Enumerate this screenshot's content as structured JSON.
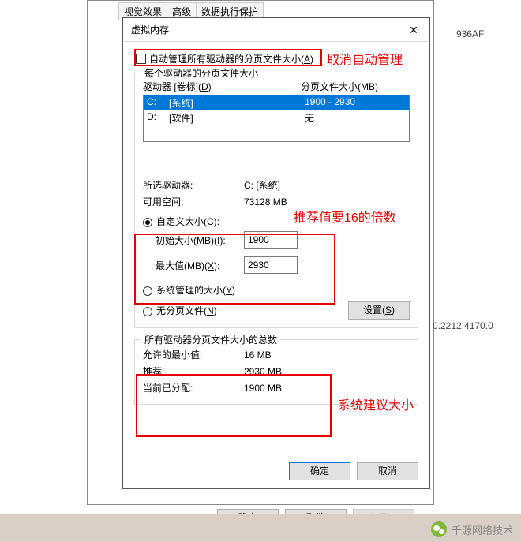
{
  "bg_text_1": "936AF",
  "bg_text_2": "0.2212.4170.0",
  "parent_tabs": {
    "t1": "视觉效果",
    "t2": "高级",
    "t3": "数据执行保护"
  },
  "parent_buttons": {
    "ok": "确定",
    "cancel": "取消",
    "apply": "应用(A)"
  },
  "dialog": {
    "title": "虚拟内存",
    "auto_label_pre": "自动管理所有驱动器的分页文件大小(",
    "auto_label_hot": "A",
    "auto_label_post": ")",
    "group1_title": "每个驱动器的分页文件大小",
    "drive_header_pre": "驱动器 [卷标](",
    "drive_header_hot": "D",
    "drive_header_post": ")",
    "size_header": "分页文件大小(MB)",
    "drives": [
      {
        "letter": "C:",
        "label": "[系统]",
        "size": "1900 - 2930",
        "selected": true
      },
      {
        "letter": "D:",
        "label": "[软件]",
        "size": "无",
        "selected": false
      }
    ],
    "selected_drive_label": "所选驱动器:",
    "selected_drive_value": "C:  [系统]",
    "avail_label": "可用空间:",
    "avail_value": "73128 MB",
    "radio_custom_pre": "自定义大小(",
    "radio_custom_hot": "C",
    "radio_custom_post": "):",
    "init_label_pre": "初始大小(MB)(",
    "init_label_hot": "I",
    "init_label_post": "):",
    "init_value": "1900",
    "max_label_pre": "最大值(MB)(",
    "max_label_hot": "X",
    "max_label_post": "):",
    "max_value": "2930",
    "radio_sys_pre": "系统管理的大小(",
    "radio_sys_hot": "Y",
    "radio_sys_post": ")",
    "radio_none_pre": "无分页文件(",
    "radio_none_hot": "N",
    "radio_none_post": ")",
    "set_btn_pre": "设置(",
    "set_btn_hot": "S",
    "set_btn_post": ")",
    "group2_title": "所有驱动器分页文件大小的总数",
    "min_label": "允许的最小值:",
    "min_value": "16 MB",
    "rec_label": "推荐:",
    "rec_value": "2930 MB",
    "cur_label": "当前已分配:",
    "cur_value": "1900 MB",
    "ok": "确定",
    "cancel": "取消"
  },
  "annotations": {
    "a1": "取消自动管理",
    "a2": "推荐值要16的倍数",
    "a3": "系统建议大小"
  },
  "wechat": "千源网络技术"
}
